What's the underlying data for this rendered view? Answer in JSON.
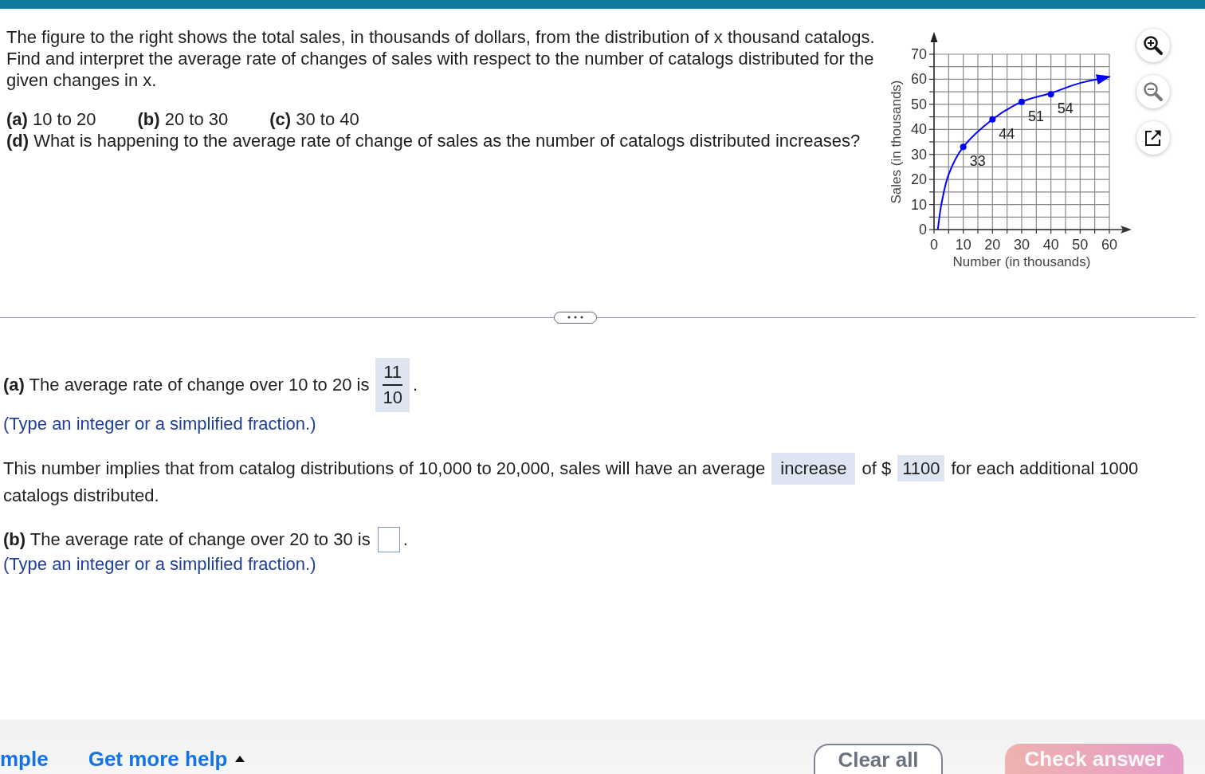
{
  "question": {
    "text": "The figure to the right shows the total sales, in thousands of dollars, from the distribution of x thousand catalogs. Find and interpret the average rate of changes of sales with respect to the number of catalogs distributed for the given changes in x.",
    "parts": [
      "**(a)** 10 to 20",
      "**(b)** 20 to 30",
      "**(c)** 30 to 40"
    ],
    "followup": "**(d)** What is happening to the average rate of change of sales as the number of catalogs distributed increases?"
  },
  "figure": {
    "chart_data": [
      {
        "type": "line",
        "xlabel": "Number (in thousands)",
        "ylabel": "Sales (in thousands)",
        "xlim": [
          0,
          60
        ],
        "ylim": [
          0,
          70
        ],
        "xticks": [
          0,
          10,
          20,
          30,
          40,
          50,
          60
        ],
        "yticks": [
          0,
          10,
          20,
          30,
          40,
          50,
          60,
          70
        ],
        "grid": true,
        "series": [
          {
            "type": "line",
            "color": "#0000ff",
            "x": [
              1.3,
              2.5,
              5,
              10,
              20,
              30,
              40,
              50,
              60
            ],
            "values": [
              0,
              10,
              22,
              33,
              44,
              51,
              54.5,
              58.5,
              61
            ]
          },
          {
            "type": "scatter",
            "color": "#0000ff",
            "x": [
              10,
              20,
              30,
              40
            ],
            "values": [
              33,
              44,
              51,
              54
            ],
            "data_labels": true
          }
        ]
      }
    ]
  },
  "tools": [
    {
      "kind": "zoom_in",
      "disabled": false
    },
    {
      "kind": "zoom_out",
      "disabled": true
    },
    {
      "kind": "popout",
      "disabled": false
    }
  ],
  "answers": [
    {
      "kind": "question",
      "prompt": "**(a)** The average rate of change over 10 to 20 is",
      "answer": {
        "kind": "fraction",
        "numerator": "11",
        "denominator": "10"
      },
      "after": ".",
      "hint": "(Type an integer or a simplified fraction.)"
    },
    {
      "kind": "sentence",
      "segments": [
        {
          "kind": "text",
          "text": "This number implies that from catalog distributions of 10,000 to 20,000, sales will have an average"
        },
        {
          "kind": "dropdown",
          "value": "increase"
        },
        {
          "kind": "text",
          "text": "of $"
        },
        {
          "kind": "input",
          "value": "1100"
        },
        {
          "kind": "text",
          "text": "for each additional 1000"
        },
        {
          "kind": "text",
          "text": "catalogs distributed."
        }
      ]
    },
    {
      "kind": "question",
      "prompt": "**(b)** The average rate of change over 20 to 30 is",
      "answer": {
        "kind": "input"
      },
      "after": ".",
      "hint": "(Type an integer or a simplified fraction.)"
    }
  ],
  "footer": {
    "links": [
      {
        "label": "mple",
        "menu": false
      },
      {
        "label": "Get more help",
        "menu": true
      }
    ],
    "buttons": [
      {
        "label": "Clear all",
        "kind": "secondary",
        "disabled": false
      },
      {
        "label": "Check answer",
        "kind": "primary",
        "disabled": true
      }
    ]
  }
}
